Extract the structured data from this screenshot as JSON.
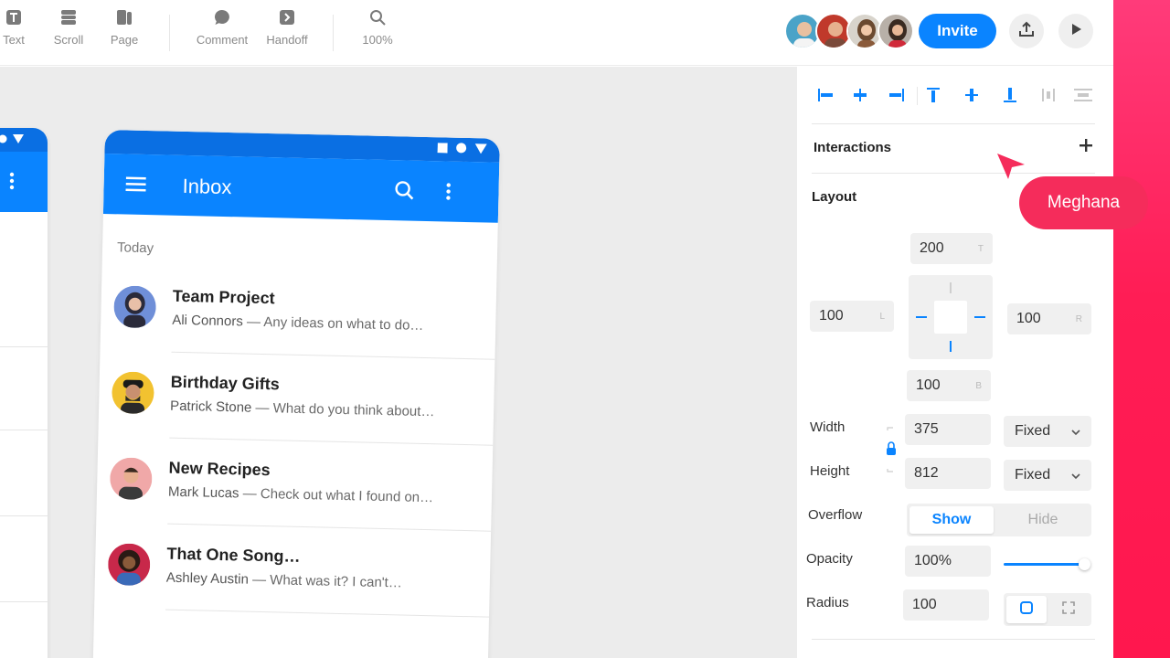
{
  "colors": {
    "accent": "#0a84ff",
    "cursor": "#f52c5b",
    "strip": "#ff1d55"
  },
  "toolbar": {
    "tools": [
      {
        "label": "Text",
        "icon": "text-icon"
      },
      {
        "label": "Scroll",
        "icon": "scroll-icon"
      },
      {
        "label": "Page",
        "icon": "page-icon"
      },
      {
        "label": "Comment",
        "icon": "comment-icon"
      },
      {
        "label": "Handoff",
        "icon": "handoff-icon"
      },
      {
        "label": "100%",
        "icon": "zoom-icon"
      }
    ],
    "invite_label": "Invite",
    "collaborators": [
      "collaborator-1",
      "collaborator-2",
      "collaborator-3",
      "collaborator-4"
    ]
  },
  "phone": {
    "title": "Inbox",
    "section": "Today",
    "items": [
      {
        "subject": "Team Project",
        "sender": "Ali Connors",
        "preview": " — Any ideas on what to do…"
      },
      {
        "subject": "Birthday Gifts",
        "sender": "Patrick Stone",
        "preview": " — What do you think about…"
      },
      {
        "subject": "New Recipes",
        "sender": "Mark Lucas",
        "preview": " — Check out what I found on…"
      },
      {
        "subject": "That One Song…",
        "sender": "Ashley Austin",
        "preview": " — What was it? I can't…"
      }
    ]
  },
  "panel": {
    "interactions_title": "Interactions",
    "layout_title": "Layout",
    "margins": {
      "top": "200",
      "top_suffix": "T",
      "left": "100",
      "left_suffix": "L",
      "right": "100",
      "right_suffix": "R",
      "bottom": "100",
      "bottom_suffix": "B"
    },
    "width_label": "Width",
    "width_value": "375",
    "width_mode": "Fixed",
    "height_label": "Height",
    "height_value": "812",
    "height_mode": "Fixed",
    "overflow_label": "Overflow",
    "overflow_show": "Show",
    "overflow_hide": "Hide",
    "opacity_label": "Opacity",
    "opacity_value": "100%",
    "opacity_fraction": 1.0,
    "radius_label": "Radius",
    "radius_value": "100"
  },
  "cursor": {
    "name": "Meghana"
  }
}
